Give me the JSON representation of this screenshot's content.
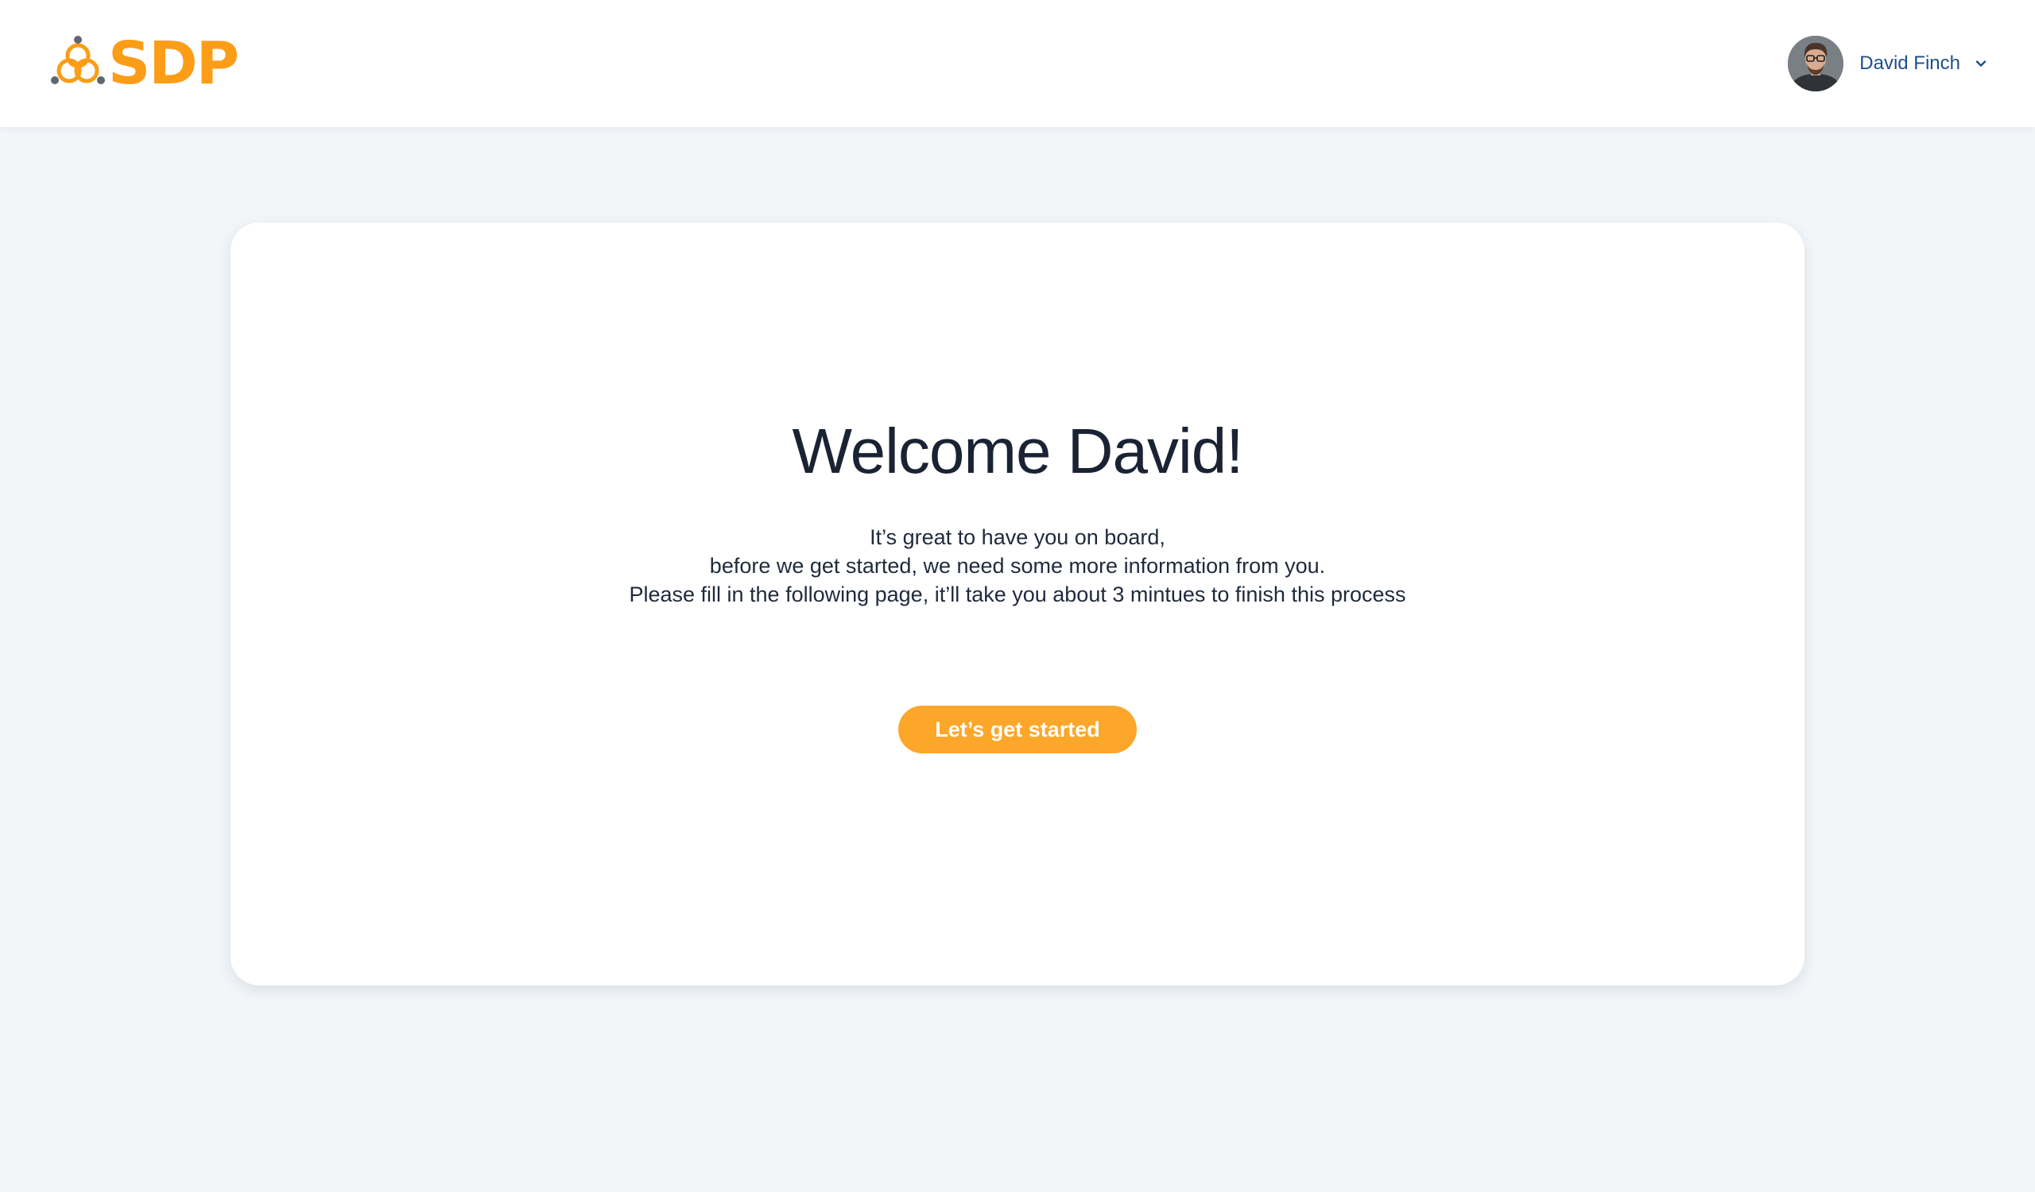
{
  "brand": {
    "logo_text": "SDP",
    "logo_icon": "sdp-trefoil-logo-icon",
    "color": "#fb9d17"
  },
  "user": {
    "name": "David Finch",
    "avatar_icon": "user-avatar-photo",
    "menu_icon": "chevron-down-icon",
    "name_color": "#1d4f8c"
  },
  "welcome": {
    "title": "Welcome David!",
    "lines": [
      "It’s great to have you on board,",
      "before we get started, we need some more information from you.",
      "Please fill in the following page, it’ll take you about 3 mintues to finish this process"
    ],
    "cta_label": "Let’s get started",
    "cta_color": "#fca62a"
  },
  "colors": {
    "page_background": "#f2f6f9",
    "card_background": "#ffffff",
    "title_text": "#1a2333"
  }
}
